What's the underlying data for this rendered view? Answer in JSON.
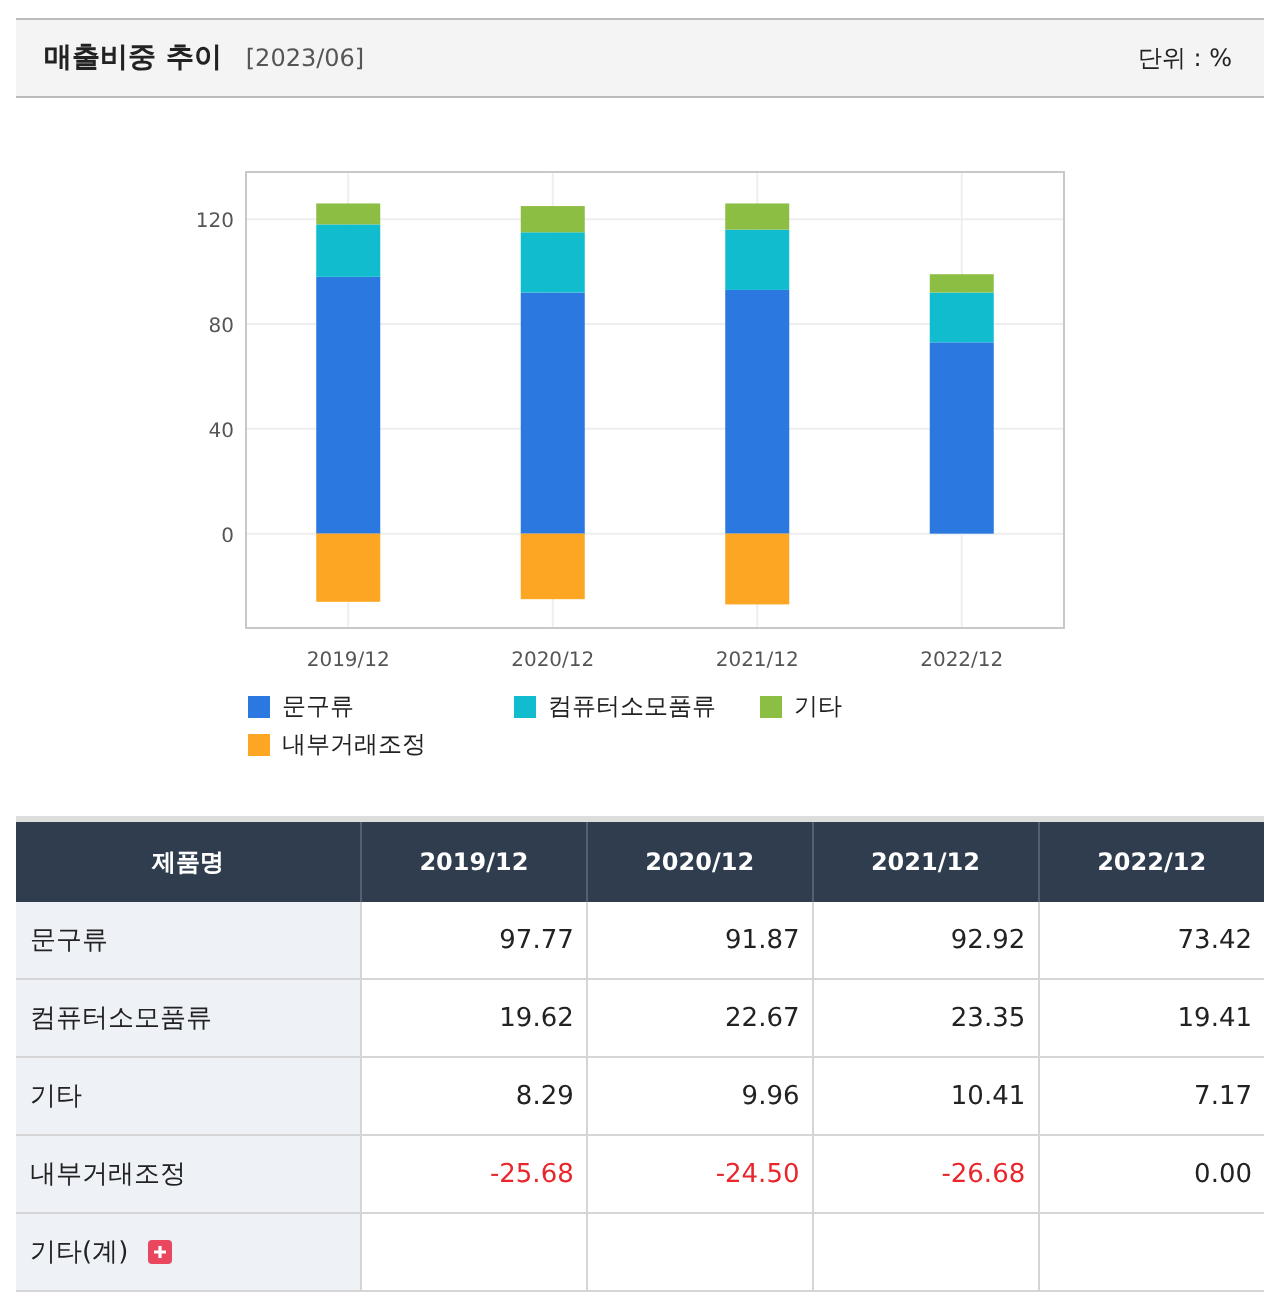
{
  "header": {
    "title": "매출비중 추이",
    "period": "[2023/06]",
    "unit": "단위 : %"
  },
  "chart_data": {
    "type": "bar",
    "stacked": true,
    "grid": true,
    "legend": true,
    "categories": [
      "2019/12",
      "2020/12",
      "2021/12",
      "2022/12"
    ],
    "ylim": [
      -36,
      138
    ],
    "yticks": [
      0,
      40,
      80,
      120
    ],
    "series": [
      {
        "name": "문구류",
        "color": "#2a78e0",
        "values": [
          98,
          92,
          93,
          73
        ]
      },
      {
        "name": "컴퓨터소모품류",
        "color": "#12bccf",
        "values": [
          20,
          23,
          23,
          19
        ]
      },
      {
        "name": "기타",
        "color": "#8cbe44",
        "values": [
          8,
          10,
          10,
          7
        ]
      },
      {
        "name": "내부거래조정",
        "color": "#fca623",
        "values": [
          -26,
          -25,
          -27,
          0
        ]
      }
    ]
  },
  "table": {
    "columns": [
      "제품명",
      "2019/12",
      "2020/12",
      "2021/12",
      "2022/12"
    ],
    "rows": [
      {
        "cells": [
          {
            "text": "문구류"
          },
          {
            "text": "97.77",
            "negative": false
          },
          {
            "text": "91.87",
            "negative": false
          },
          {
            "text": "92.92",
            "negative": false
          },
          {
            "text": "73.42",
            "negative": false
          }
        ]
      },
      {
        "cells": [
          {
            "text": "컴퓨터소모품류"
          },
          {
            "text": "19.62",
            "negative": false
          },
          {
            "text": "22.67",
            "negative": false
          },
          {
            "text": "23.35",
            "negative": false
          },
          {
            "text": "19.41",
            "negative": false
          }
        ]
      },
      {
        "cells": [
          {
            "text": "기타"
          },
          {
            "text": "8.29",
            "negative": false
          },
          {
            "text": "9.96",
            "negative": false
          },
          {
            "text": "10.41",
            "negative": false
          },
          {
            "text": "7.17",
            "negative": false
          }
        ]
      },
      {
        "cells": [
          {
            "text": "내부거래조정"
          },
          {
            "text": "-25.68",
            "negative": true
          },
          {
            "text": "-24.50",
            "negative": true
          },
          {
            "text": "-26.68",
            "negative": true
          },
          {
            "text": "0.00",
            "negative": false
          }
        ]
      },
      {
        "cells": [
          {
            "text": "기타(계)",
            "expandable": true
          },
          {
            "text": ""
          },
          {
            "text": ""
          },
          {
            "text": ""
          },
          {
            "text": ""
          }
        ]
      }
    ]
  }
}
